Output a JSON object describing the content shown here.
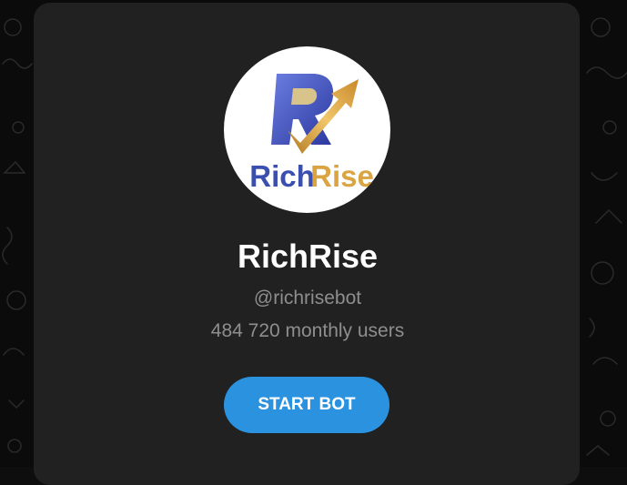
{
  "bot": {
    "name": "RichRise",
    "handle": "@richrisebot",
    "monthly_users": "484 720 monthly users",
    "logo_text_part1": "Rich",
    "logo_text_part2": "Rise",
    "logo_icon": "richrise-logo-icon"
  },
  "actions": {
    "start_label": "START BOT"
  },
  "colors": {
    "background": "#0b0b0b",
    "card": "#212121",
    "accent": "#2b92e0",
    "secondary_text": "#8e8e8e",
    "logo_blue": "#3a4fb0",
    "logo_gold": "#d9a441"
  }
}
